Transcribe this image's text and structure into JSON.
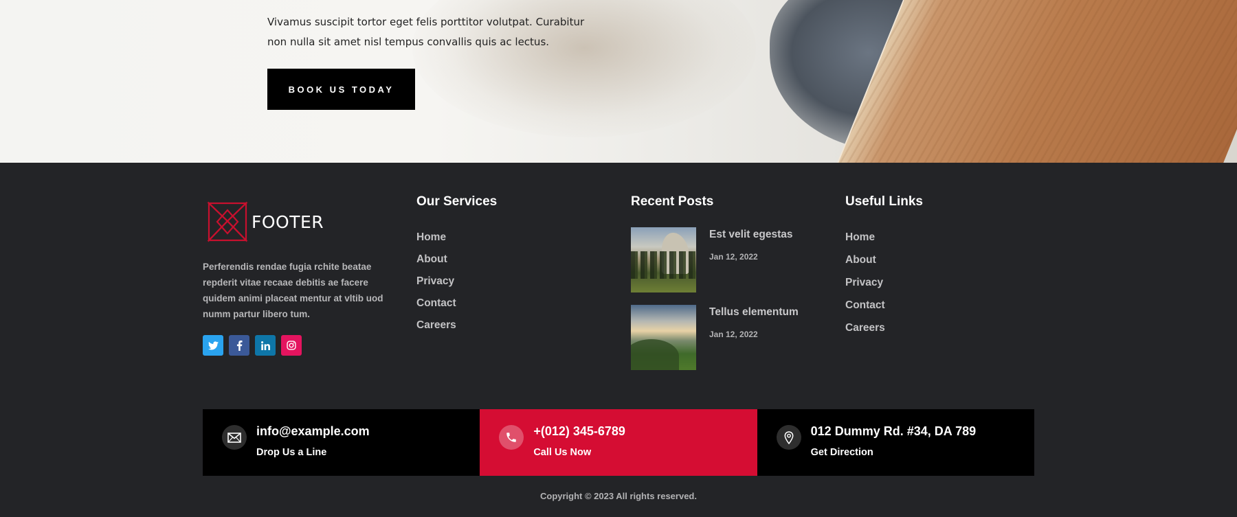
{
  "hero": {
    "text": "Vivamus suscipit tortor eget felis porttitor volutpat. Curabitur non nulla sit amet nisl tempus convallis quis ac lectus.",
    "button_label": "BOOK US TODAY"
  },
  "footer": {
    "logo_text": "FOOTER",
    "about": "Perferendis rendae fugia rchite beatae repderit vitae recaae debitis ae facere quidem animi placeat mentur at vltib uod numm partur libero tum.",
    "socials": [
      {
        "name": "twitter-icon",
        "glyph": "t"
      },
      {
        "name": "facebook-icon",
        "glyph": "f"
      },
      {
        "name": "linkedin-icon",
        "glyph": "in"
      },
      {
        "name": "instagram-icon",
        "glyph": "◎"
      }
    ],
    "services": {
      "title": "Our Services",
      "items": [
        "Home",
        "About",
        "Privacy",
        "Contact",
        "Careers"
      ]
    },
    "recent_posts": {
      "title": "Recent Posts",
      "items": [
        {
          "title": "Est velit egestas",
          "date": "Jan 12, 2022"
        },
        {
          "title": "Tellus elementum",
          "date": "Jan 12, 2022"
        }
      ]
    },
    "useful_links": {
      "title": "Useful Links",
      "items": [
        "Home",
        "About",
        "Privacy",
        "Contact",
        "Careers"
      ]
    },
    "contact_bar": [
      {
        "icon": "envelope-icon",
        "main": "info@example.com",
        "sub": "Drop Us a Line"
      },
      {
        "icon": "phone-icon",
        "main": "+(012) 345-6789",
        "sub": "Call Us Now"
      },
      {
        "icon": "map-pin-icon",
        "main": "012 Dummy Rd. #34, DA 789",
        "sub": "Get Direction"
      }
    ],
    "copyright": "Copyright © 2023 All rights reserved."
  },
  "colors": {
    "accent_red": "#d50d33",
    "footer_bg": "#232427",
    "logo_red": "#c8102e"
  }
}
